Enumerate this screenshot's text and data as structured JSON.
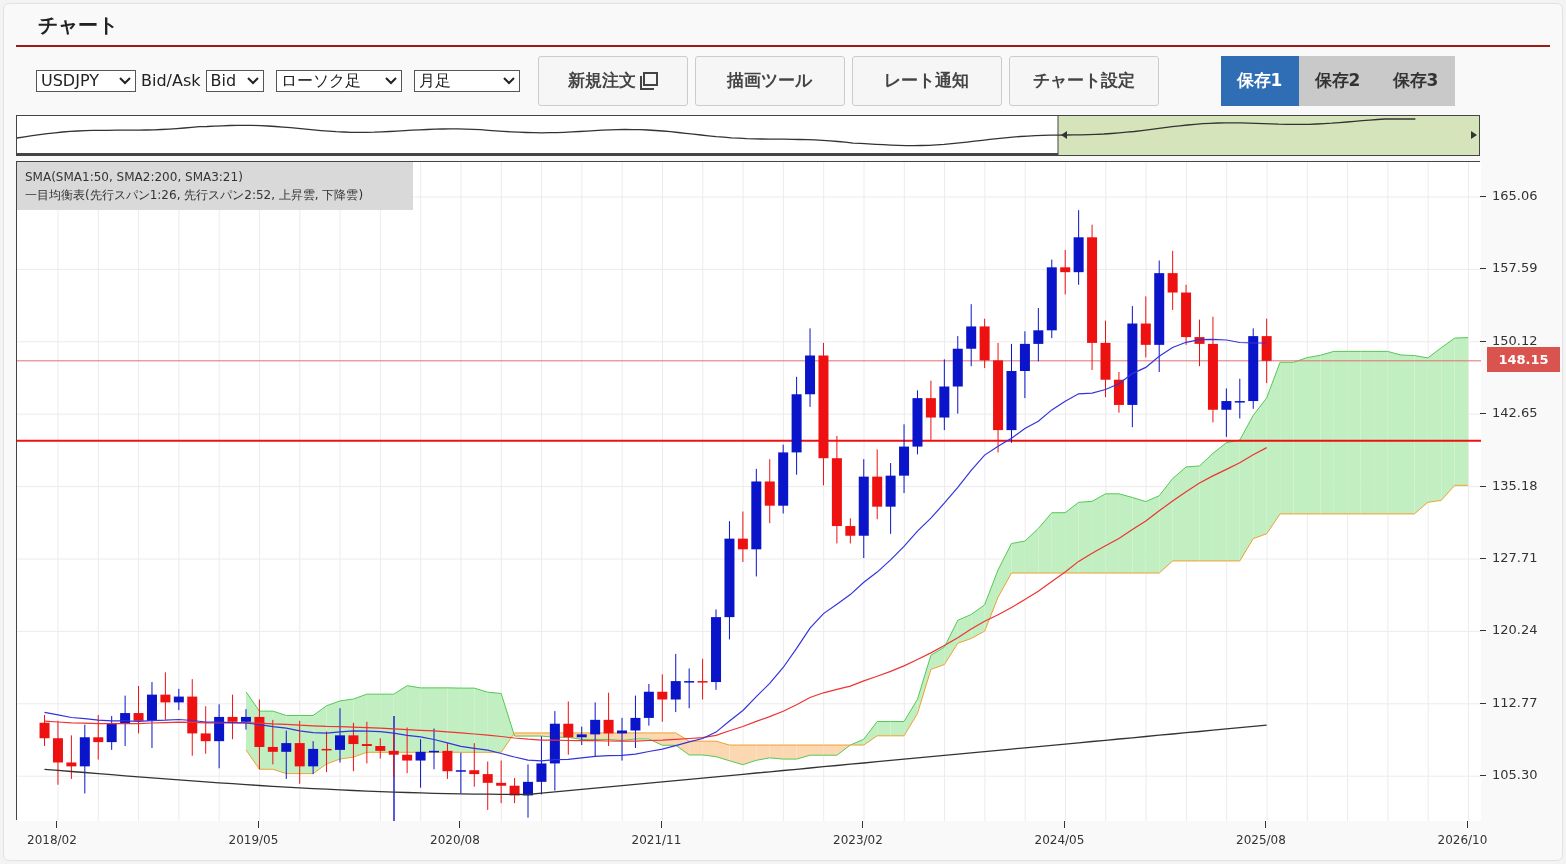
{
  "title": "チャート",
  "toolbar": {
    "symbol": "USDJPY",
    "price_type_label": "Bid/Ask",
    "price_type": "Bid",
    "chart_type": "ローソク足",
    "period": "月足"
  },
  "buttons": [
    {
      "label": "新規注文",
      "kind": "window"
    },
    {
      "label": "描画ツール",
      "kind": "plain"
    },
    {
      "label": "レート通知",
      "kind": "plain"
    },
    {
      "label": "チャート設定",
      "kind": "plain"
    }
  ],
  "saves": [
    {
      "label": "保存1",
      "selected": true
    },
    {
      "label": "保存2",
      "selected": false
    },
    {
      "label": "保存3",
      "selected": false
    }
  ],
  "legend": [
    "SMA(SMA1:50, SMA2:200, SMA3:21)",
    "一目均衡表(先行スパン1:26, 先行スパン2:52, 上昇雲, 下降雲)"
  ],
  "current_price": "148.15",
  "price_axis": [
    "165.06",
    "157.59",
    "150.12",
    "142.65",
    "135.18",
    "127.71",
    "120.24",
    "112.77",
    "105.30"
  ],
  "time_axis": [
    "2018/02",
    "2019/05",
    "2020/08",
    "2021/11",
    "2023/02",
    "2024/05",
    "2025/08",
    "2026/10"
  ]
}
